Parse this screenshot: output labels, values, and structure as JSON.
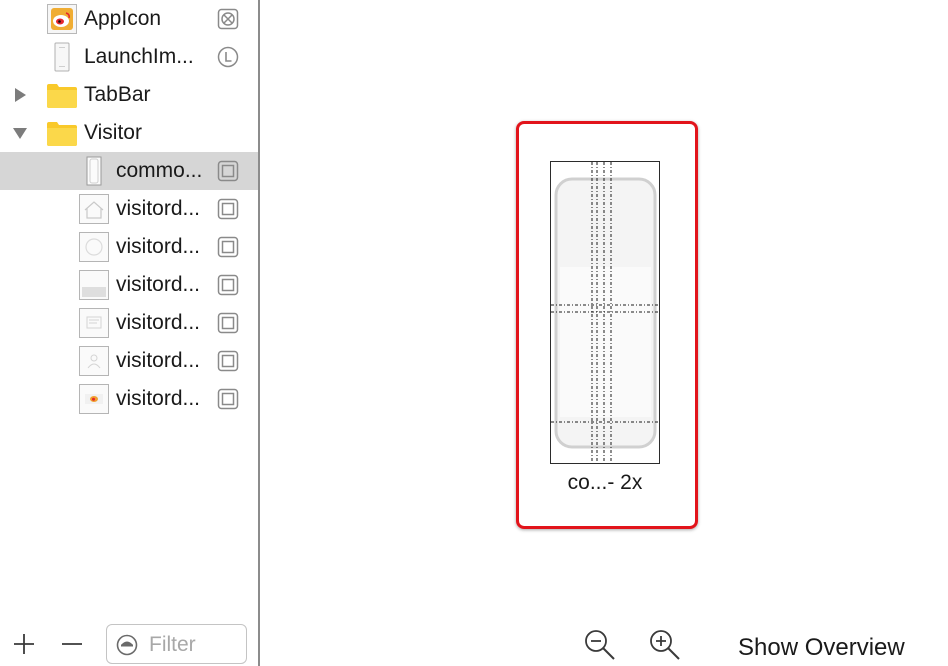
{
  "sidebar": {
    "items": [
      {
        "label": "AppIcon",
        "kind": "appicon",
        "badge": "appicon-badge"
      },
      {
        "label": "LaunchIm...",
        "kind": "launch",
        "badge": "launch-badge"
      },
      {
        "label": "TabBar",
        "kind": "folder",
        "expanded": false
      },
      {
        "label": "Visitor",
        "kind": "folder",
        "expanded": true
      },
      {
        "label": "commo...",
        "kind": "image",
        "selected": true,
        "badge": "image-badge"
      },
      {
        "label": "visitord...",
        "kind": "image",
        "badge": "image-badge"
      },
      {
        "label": "visitord...",
        "kind": "image",
        "badge": "image-badge"
      },
      {
        "label": "visitord...",
        "kind": "image",
        "badge": "image-badge"
      },
      {
        "label": "visitord...",
        "kind": "image",
        "badge": "image-badge"
      },
      {
        "label": "visitord...",
        "kind": "image",
        "badge": "image-badge"
      },
      {
        "label": "visitord...",
        "kind": "image",
        "badge": "image-badge"
      }
    ],
    "add_label": "+",
    "remove_label": "—",
    "filter_placeholder": "Filter"
  },
  "canvas": {
    "image_caption": "co...- 2x",
    "show_overview_label": "Show Overview",
    "selection_color": "#e2141b"
  },
  "colors": {
    "folder": "#f9cd2e",
    "selected_row": "#d6d6d6",
    "divider": "#8c8c8c"
  }
}
